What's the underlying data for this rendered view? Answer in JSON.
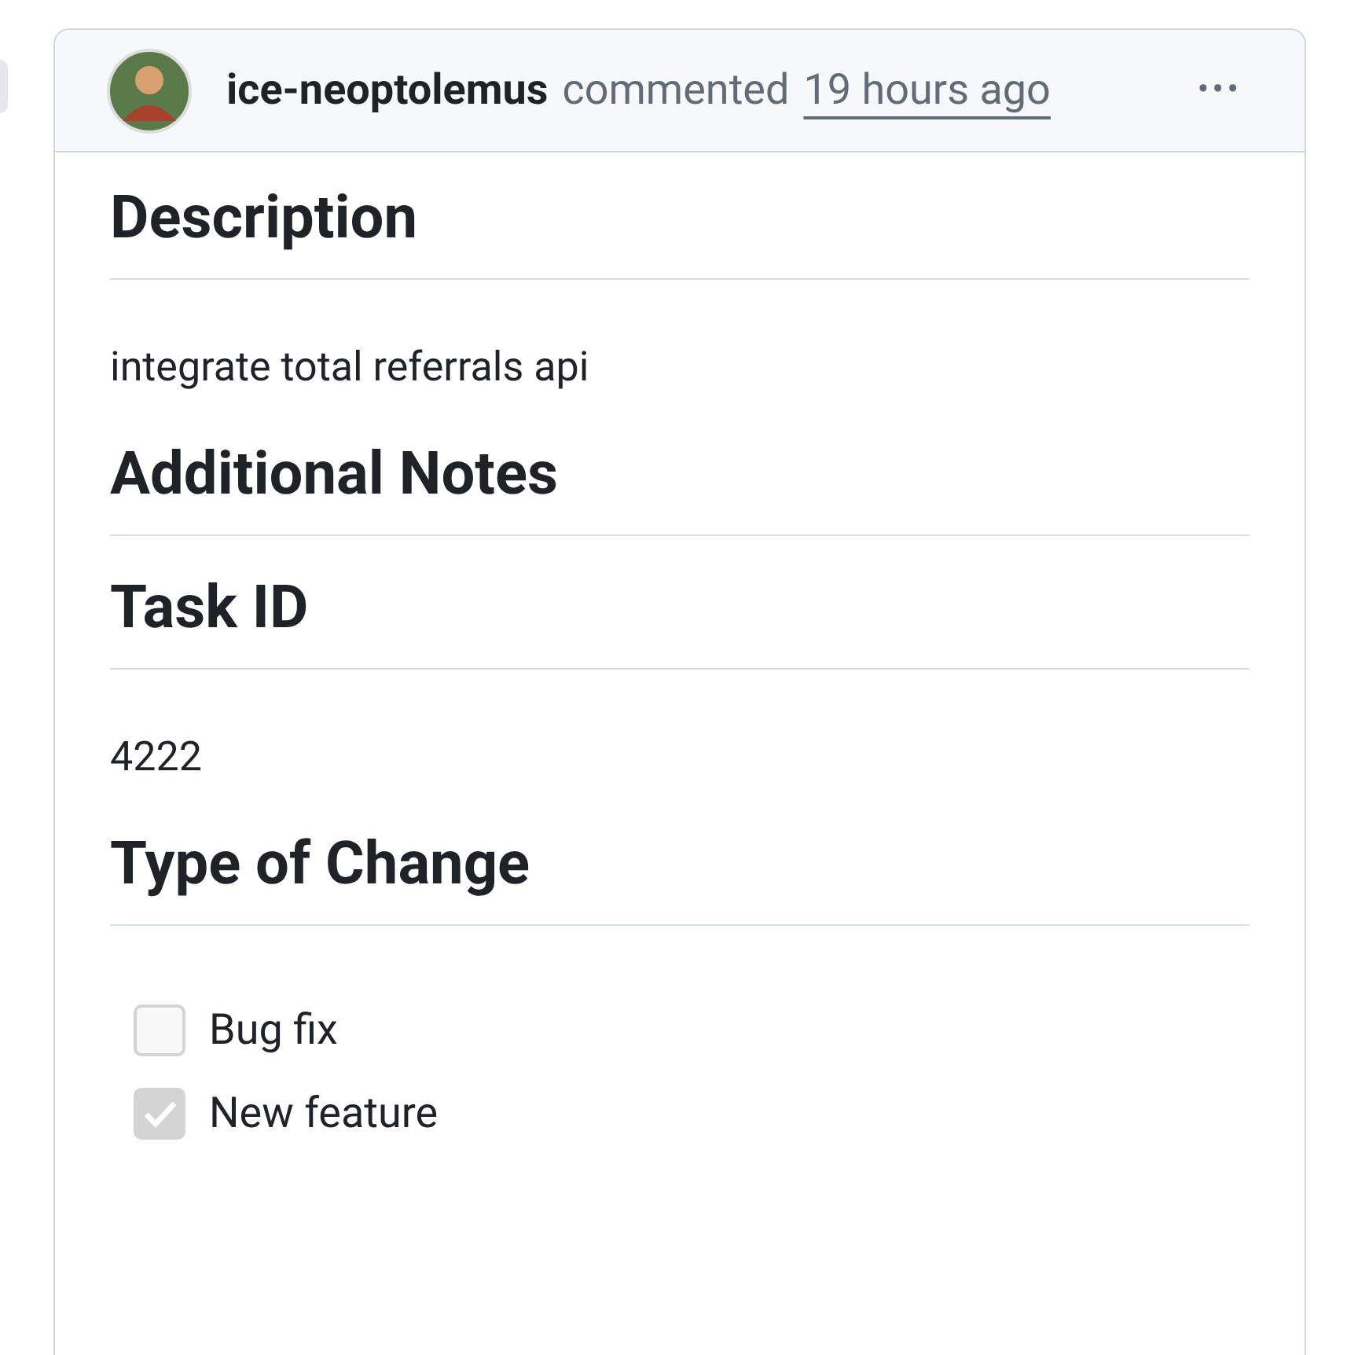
{
  "comment": {
    "author": "ice-neoptolemus",
    "action": "commented",
    "time": "19 hours ago",
    "menu": "•••"
  },
  "body": [
    {
      "kind": "heading",
      "text": "Description"
    },
    {
      "kind": "paragraph",
      "text": "integrate total referrals api"
    },
    {
      "kind": "heading",
      "text": "Additional Notes"
    },
    {
      "kind": "heading",
      "text": "Task ID"
    },
    {
      "kind": "paragraph",
      "text": "4222"
    },
    {
      "kind": "heading",
      "text": "Type of Change"
    },
    {
      "kind": "checkbox",
      "text": "Bug fix",
      "checked": false
    },
    {
      "kind": "checkbox",
      "text": "New feature",
      "checked": true
    }
  ]
}
